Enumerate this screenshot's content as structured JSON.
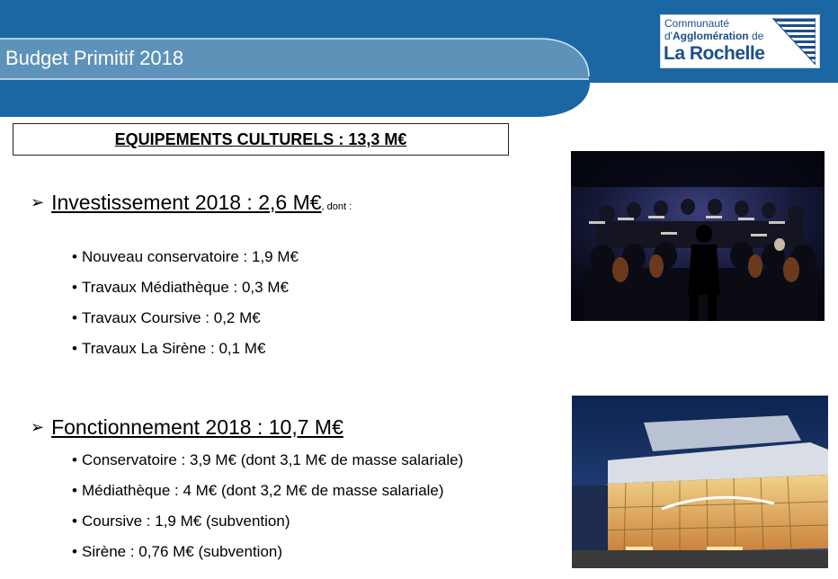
{
  "header": {
    "title": "Budget Primitif 2018",
    "colors": {
      "banner": "#1b67a3",
      "band": "#5d93b9"
    },
    "logo": {
      "line1": "Communauté",
      "line2_prefix": "d'",
      "line2_bold": "Agglomération",
      "line2_suffix": " de",
      "line3": "La Rochelle"
    }
  },
  "section_box": {
    "text": "EQUIPEMENTS CULTURELS : 13,3 M€"
  },
  "investissement": {
    "heading": "Investissement 2018 : 2,6 M€",
    "suffix": ", dont :",
    "items": [
      "Nouveau conservatoire : 1,9 M€",
      "Travaux Médiathèque : 0,3 M€",
      "Travaux Coursive : 0,2 M€",
      "Travaux La Sirène : 0,1 M€"
    ]
  },
  "fonctionnement": {
    "heading": "Fonctionnement 2018 : 10,7 M€",
    "items": [
      "Conservatoire : 3,9 M€ (dont 3,1 M€ de masse salariale)",
      "Médiathèque : 4 M€ (dont 3,2 M€ de masse salariale)",
      "Coursive : 1,9 M€ (subvention)",
      "Sirène : 0,76 M€ (subvention)"
    ]
  },
  "icons": {
    "bullet_arrow": "arrow-bullet-icon",
    "logo_mark": "triangle-stripes-icon"
  }
}
